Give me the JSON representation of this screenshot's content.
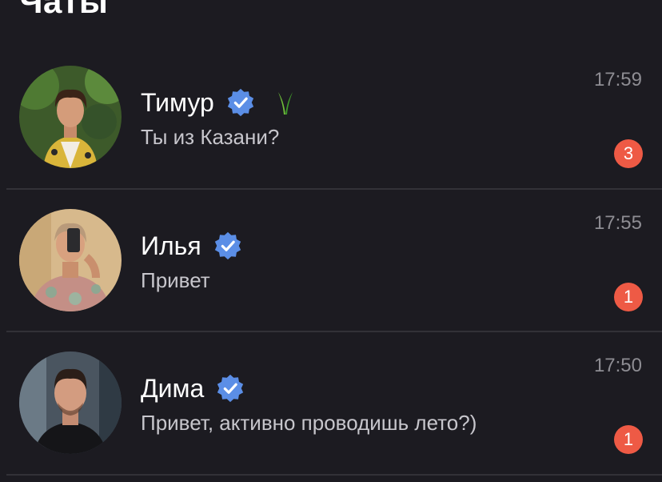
{
  "header": {
    "title": "Чаты"
  },
  "colors": {
    "background": "#1c1b21",
    "verified_badge": "#5b8ee6",
    "unread_badge": "#ee5a45",
    "secondary_text": "#8e8d93"
  },
  "chats": [
    {
      "name": "Тимур",
      "verified": true,
      "extra_icon": "plant-icon",
      "message": "Ты из Казани?",
      "time": "17:59",
      "unread": "3"
    },
    {
      "name": "Илья",
      "verified": true,
      "message": "Привет",
      "time": "17:55",
      "unread": "1"
    },
    {
      "name": "Дима",
      "verified": true,
      "message": "Привет, активно проводишь лето?)",
      "time": "17:50",
      "unread": "1"
    }
  ]
}
